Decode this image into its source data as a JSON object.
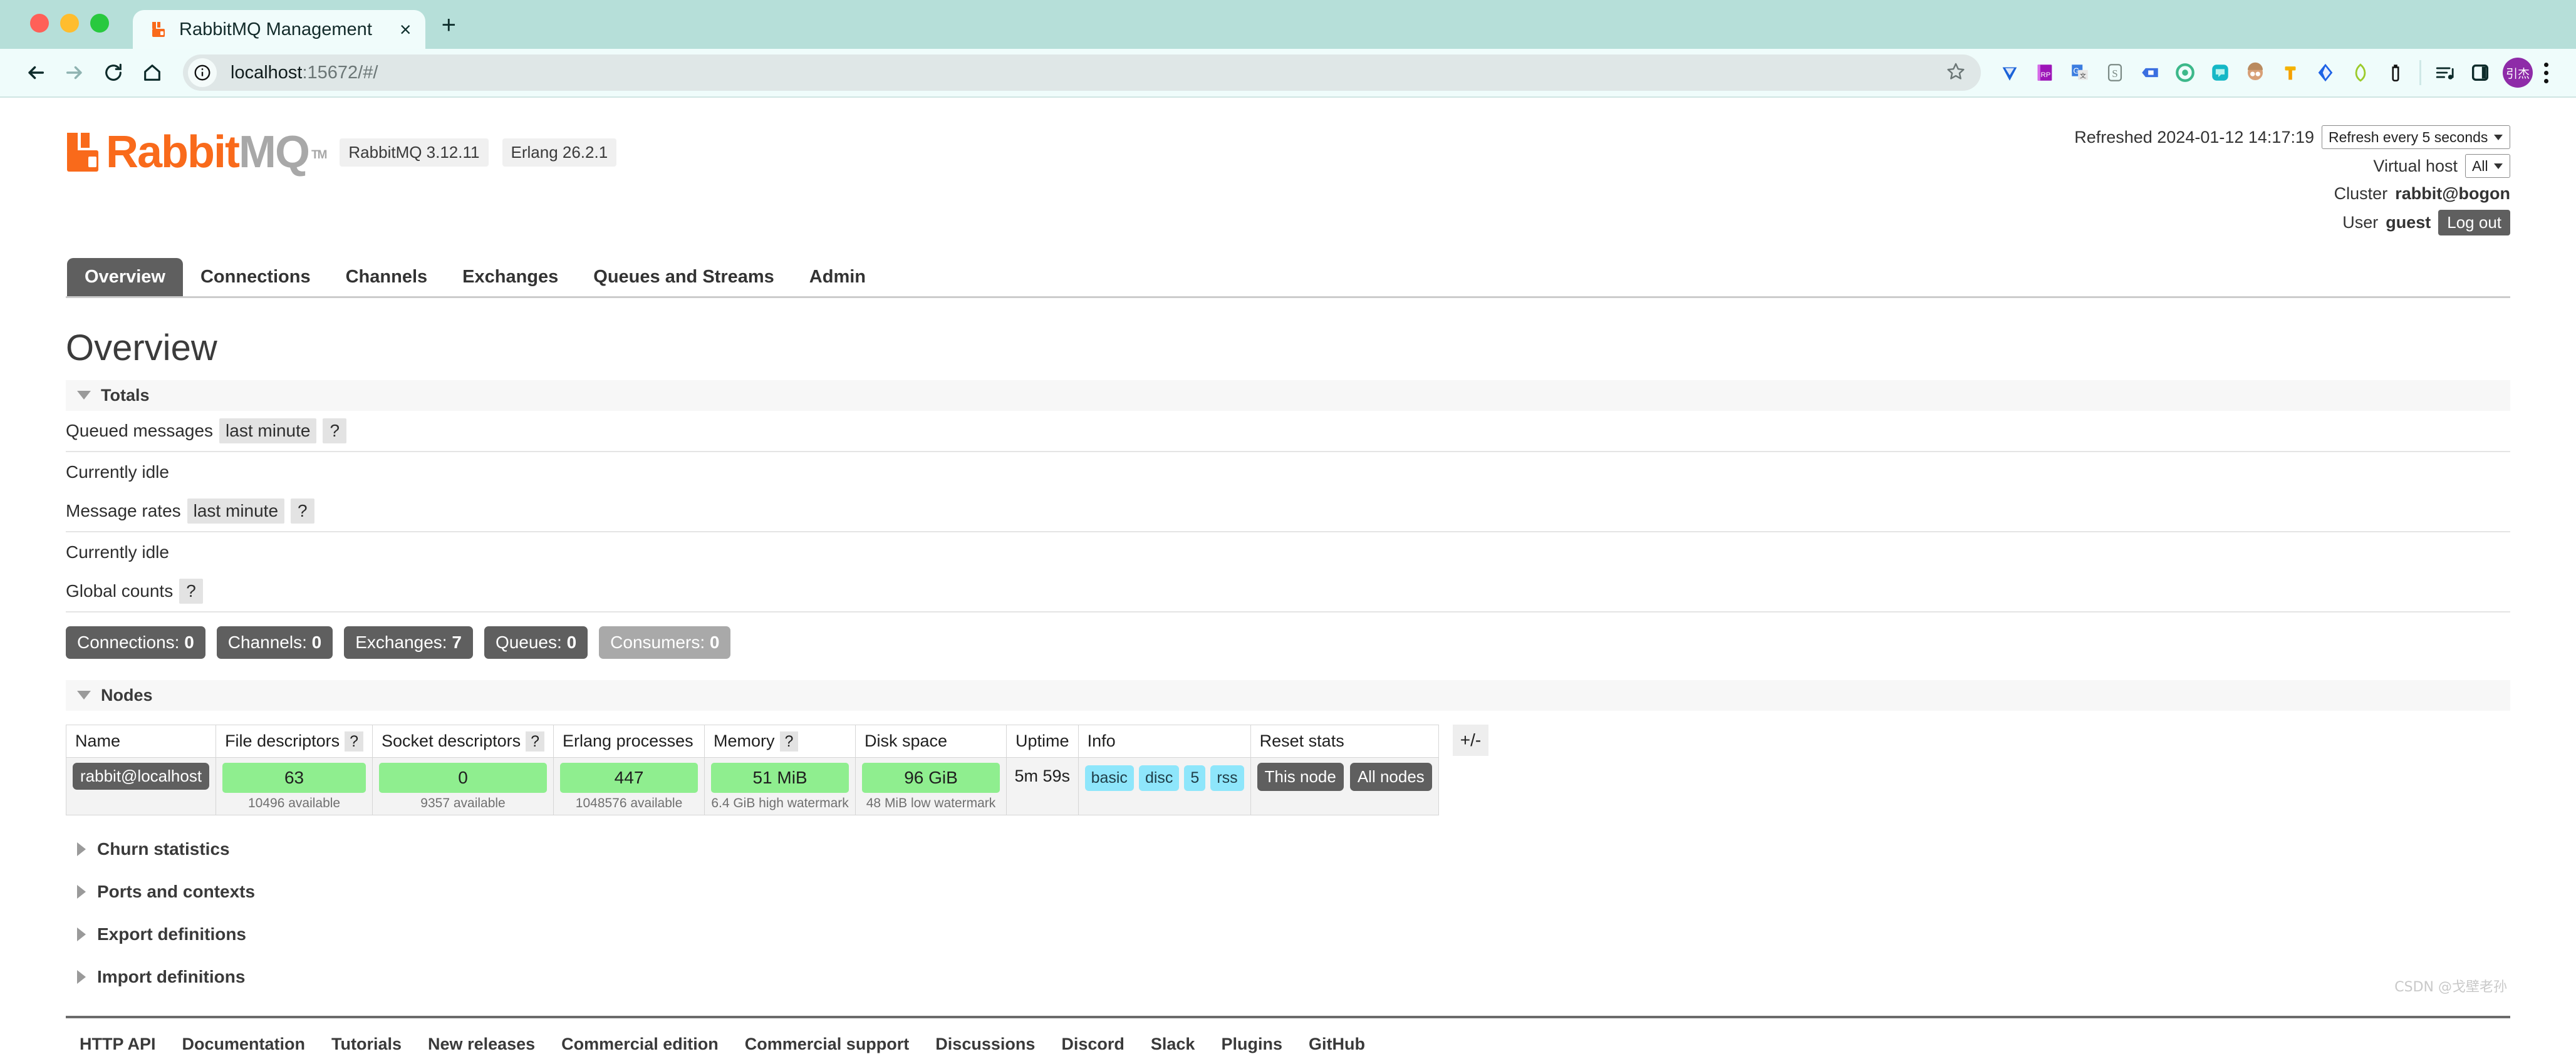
{
  "browser": {
    "tab": {
      "title": "RabbitMQ Management",
      "favicon": "rabbitmq-favicon",
      "close_label": "×"
    },
    "new_tab_label": "+",
    "nav": {
      "back": "back-arrow",
      "forward": "forward-arrow",
      "reload": "reload-icon",
      "home": "home-icon"
    },
    "omnibox": {
      "url_host": "localhost",
      "url_rest": ":15672/#/",
      "info_icon": "info-circle-icon",
      "star_icon": "bookmark-star-icon"
    },
    "extensions": [
      {
        "name": "ext-diamond-blue",
        "glyph": "▼",
        "color": "#2f6fe0"
      },
      {
        "name": "ext-rp-purple",
        "glyph": "RP",
        "color": "#a020c0"
      },
      {
        "name": "ext-google-translate",
        "glyph": "G",
        "color": "#2f6fe0"
      },
      {
        "name": "ext-s-badge",
        "glyph": "S",
        "color": "#6f7f7a"
      },
      {
        "name": "ext-bookmark-blue",
        "glyph": "▮",
        "color": "#3366dd"
      },
      {
        "name": "ext-openai",
        "glyph": "✿",
        "color": "#3dbb8c"
      },
      {
        "name": "ext-chat-teal",
        "glyph": "☁",
        "color": "#16b6c4"
      },
      {
        "name": "ext-face-avatar",
        "glyph": "☺",
        "color": "#d8a179"
      },
      {
        "name": "ext-hammer-orange",
        "glyph": "┳",
        "color": "#f5b301"
      },
      {
        "name": "ext-diamond-blue-2",
        "glyph": "◆",
        "color": "#2464e0"
      },
      {
        "name": "ext-leaf-green",
        "glyph": "◖",
        "color": "#9acd32"
      },
      {
        "name": "ext-bottle-dark",
        "glyph": "▮",
        "color": "#111111"
      }
    ],
    "media_icon": "media-list-icon",
    "sidepanel_icon": "side-panel-icon",
    "profile_avatar": "引杰",
    "menu_icon": "kebab-menu-icon"
  },
  "rabbitmq": {
    "logo": {
      "rabbit": "Rabbit",
      "mq": "MQ",
      "tm": "TM"
    },
    "version_pills": [
      "RabbitMQ 3.12.11",
      "Erlang 26.2.1"
    ],
    "status": {
      "refreshed_label": "Refreshed 2024-01-12 14:17:19",
      "refresh_select": "Refresh every 5 seconds",
      "vhost_label": "Virtual host",
      "vhost_select": "All",
      "cluster_label": "Cluster",
      "cluster_value": "rabbit@bogon",
      "user_label": "User",
      "user_value": "guest",
      "logout_label": "Log out"
    },
    "nav_tabs": [
      {
        "label": "Overview",
        "active": true
      },
      {
        "label": "Connections",
        "active": false
      },
      {
        "label": "Channels",
        "active": false
      },
      {
        "label": "Exchanges",
        "active": false
      },
      {
        "label": "Queues and Streams",
        "active": false
      },
      {
        "label": "Admin",
        "active": false
      }
    ],
    "page_title": "Overview",
    "totals": {
      "section_label": "Totals",
      "queued_messages_label": "Queued messages",
      "queued_messages_period": "last minute",
      "queued_messages_help": "?",
      "queued_idle": "Currently idle",
      "message_rates_label": "Message rates",
      "message_rates_period": "last minute",
      "message_rates_help": "?",
      "rates_idle": "Currently idle",
      "global_counts_label": "Global counts",
      "global_counts_help": "?"
    },
    "global_counts": [
      {
        "label": "Connections:",
        "value": "0",
        "muted": false
      },
      {
        "label": "Channels:",
        "value": "0",
        "muted": false
      },
      {
        "label": "Exchanges:",
        "value": "7",
        "muted": false
      },
      {
        "label": "Queues:",
        "value": "0",
        "muted": false
      },
      {
        "label": "Consumers:",
        "value": "0",
        "muted": true
      }
    ],
    "nodes": {
      "section_label": "Nodes",
      "columns": [
        {
          "label": "Name",
          "help": ""
        },
        {
          "label": "File descriptors",
          "help": "?"
        },
        {
          "label": "Socket descriptors",
          "help": "?"
        },
        {
          "label": "Erlang processes",
          "help": ""
        },
        {
          "label": "Memory",
          "help": "?"
        },
        {
          "label": "Disk space",
          "help": ""
        },
        {
          "label": "Uptime",
          "help": ""
        },
        {
          "label": "Info",
          "help": ""
        },
        {
          "label": "Reset stats",
          "help": ""
        }
      ],
      "plus_minus": "+/-",
      "row": {
        "name": "rabbit@localhost",
        "file_descriptors": {
          "value": "63",
          "sub": "10496 available"
        },
        "socket_descriptors": {
          "value": "0",
          "sub": "9357 available"
        },
        "erlang_processes": {
          "value": "447",
          "sub": "1048576 available"
        },
        "memory": {
          "value": "51 MiB",
          "sub": "6.4 GiB high watermark"
        },
        "disk_space": {
          "value": "96 GiB",
          "sub": "48 MiB low watermark"
        },
        "uptime": "5m 59s",
        "info_chips": [
          "basic",
          "disc",
          "5",
          "rss"
        ],
        "reset_buttons": [
          "This node",
          "All nodes"
        ]
      }
    },
    "collapsed_sections": [
      "Churn statistics",
      "Ports and contexts",
      "Export definitions",
      "Import definitions"
    ],
    "footer_links": [
      "HTTP API",
      "Documentation",
      "Tutorials",
      "New releases",
      "Commercial edition",
      "Commercial support",
      "Discussions",
      "Discord",
      "Slack",
      "Plugins",
      "GitHub"
    ]
  },
  "watermark": "CSDN @戈壁老孙"
}
